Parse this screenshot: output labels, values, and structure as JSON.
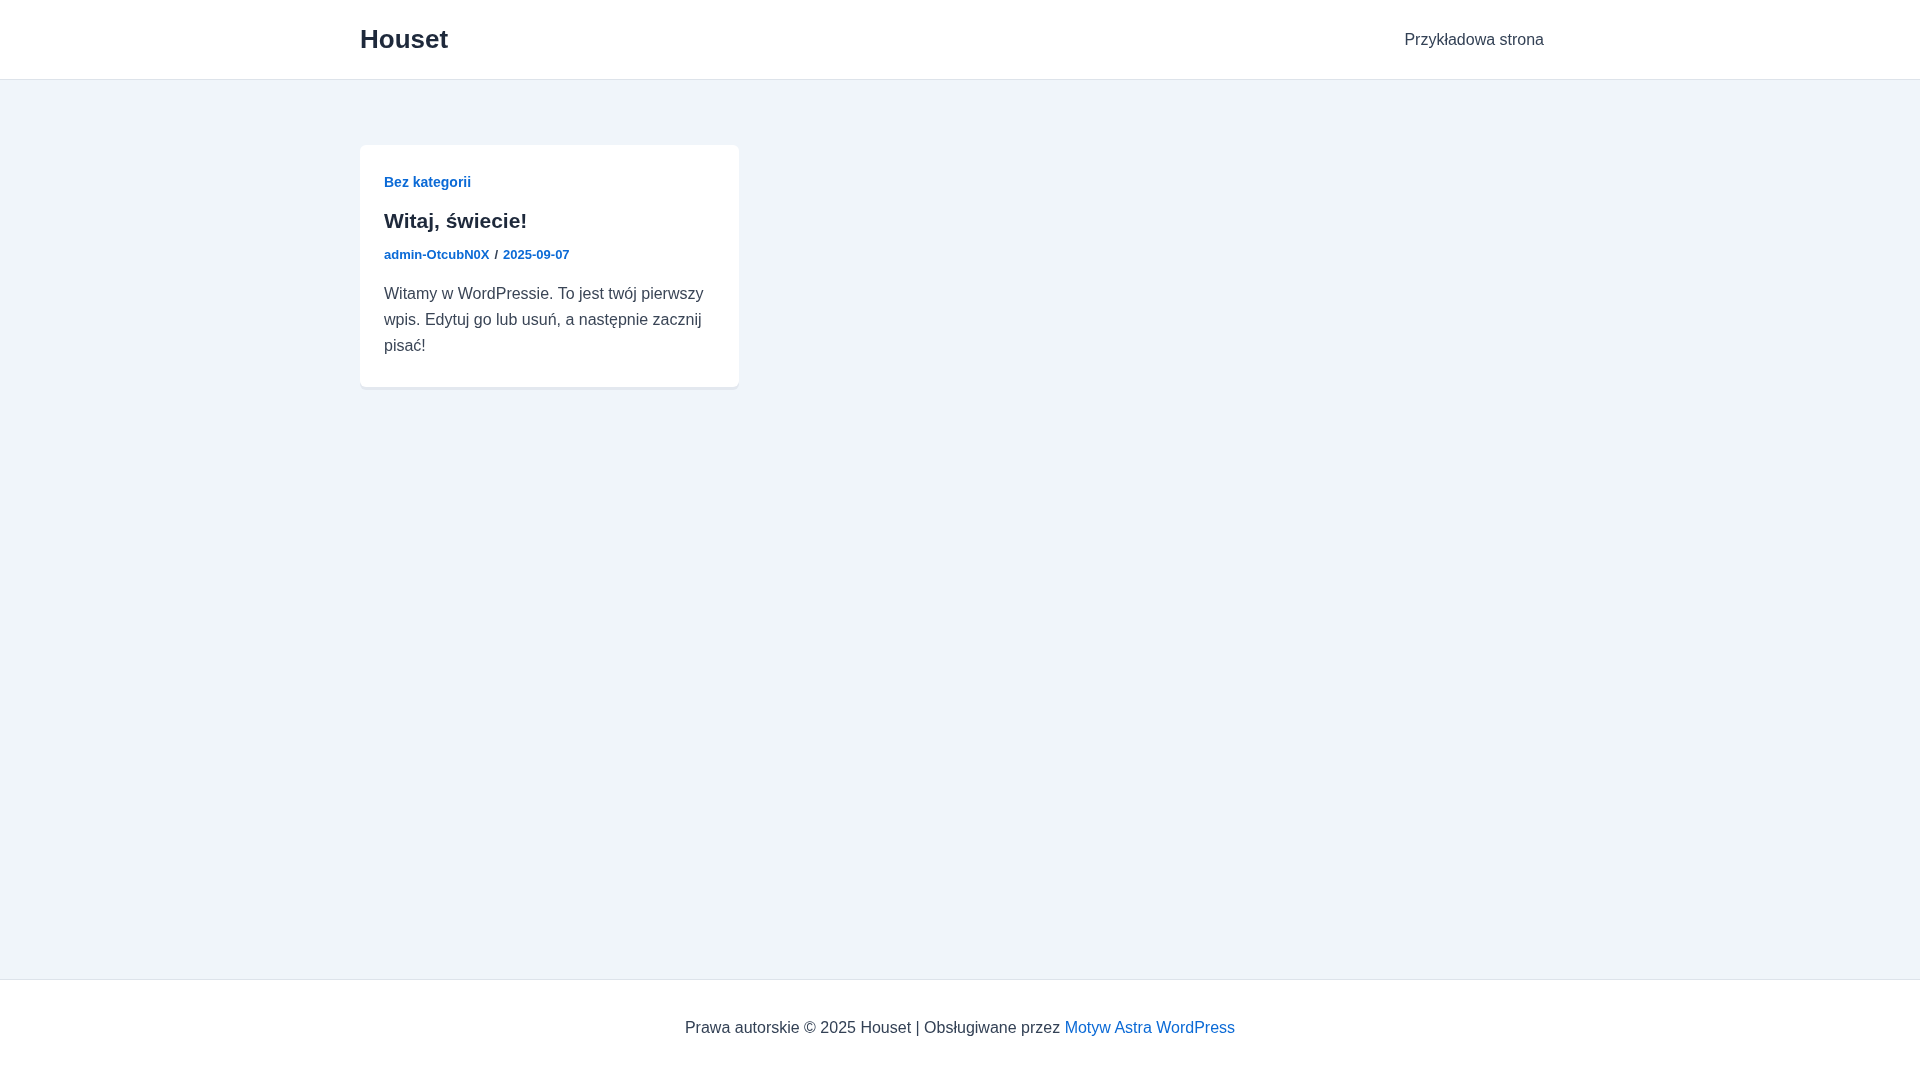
{
  "header": {
    "site_title": "Houset",
    "nav": [
      {
        "label": "Przykładowa strona"
      }
    ]
  },
  "posts": [
    {
      "category": "Bez kategorii",
      "title": "Witaj, świecie!",
      "author": "admin-OtcubN0X",
      "separator": "/",
      "date": "2025-09-07",
      "excerpt": "Witamy w WordPressie. To jest twój pierwszy wpis. Edytuj go lub usuń, a następnie zacznij pisać!"
    }
  ],
  "footer": {
    "text": "Prawa autorskie © 2025 Houset | Obsługiwane przez",
    "link": "Motyw Astra WordPress"
  }
}
